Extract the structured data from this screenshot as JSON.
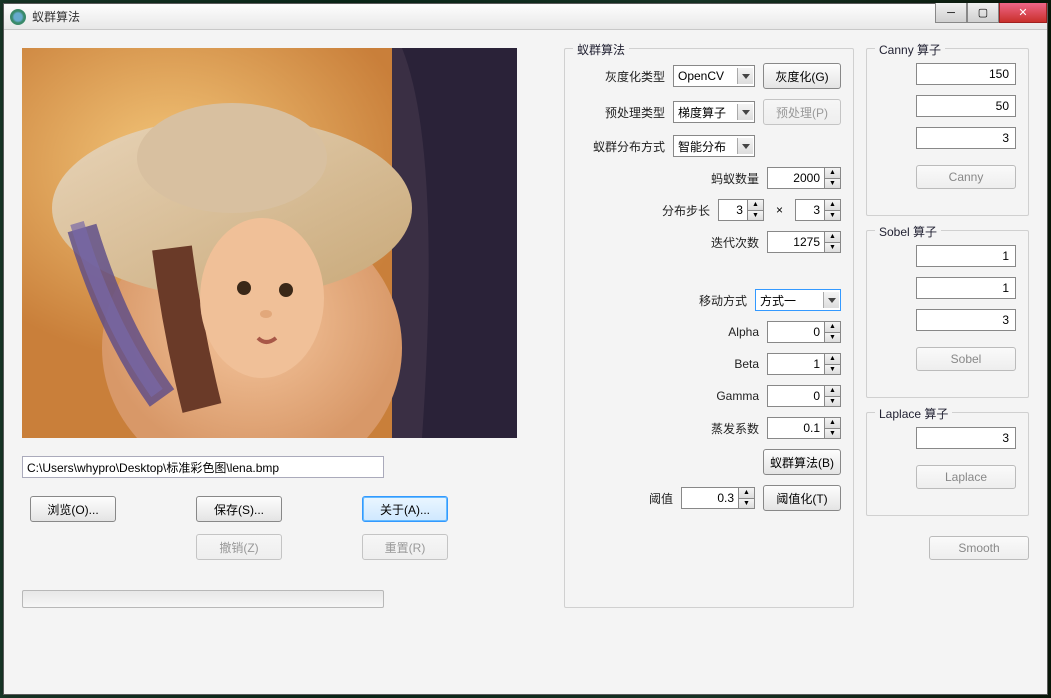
{
  "window": {
    "title": "蚁群算法"
  },
  "left": {
    "path": "C:\\Users\\whypro\\Desktop\\标准彩色图\\lena.bmp",
    "browse": "浏览(O)...",
    "save": "保存(S)...",
    "about": "关于(A)...",
    "undo": "撤销(Z)",
    "reset": "重置(R)"
  },
  "aco": {
    "title": "蚁群算法",
    "gray_type_label": "灰度化类型",
    "gray_type_value": "OpenCV",
    "gray_btn": "灰度化(G)",
    "pre_type_label": "预处理类型",
    "pre_type_value": "梯度算子",
    "pre_btn": "预处理(P)",
    "dist_label": "蚁群分布方式",
    "dist_value": "智能分布",
    "ant_count_label": "蚂蚁数量",
    "ant_count": "2000",
    "step_label": "分布步长",
    "step_x": "3",
    "step_y": "3",
    "iter_label": "迭代次数",
    "iter": "1275",
    "move_label": "移动方式",
    "move_value": "方式一",
    "alpha_label": "Alpha",
    "alpha": "0",
    "beta_label": "Beta",
    "beta": "1",
    "gamma_label": "Gamma",
    "gamma": "0",
    "evap_label": "蒸发系数",
    "evap": "0.1",
    "aco_btn": "蚁群算法(B)",
    "thresh_label": "阈值",
    "thresh": "0.3",
    "thresh_btn": "阈值化(T)"
  },
  "canny": {
    "title": "Canny 算子",
    "v1": "150",
    "v2": "50",
    "v3": "3",
    "btn": "Canny"
  },
  "sobel": {
    "title": "Sobel 算子",
    "v1": "1",
    "v2": "1",
    "v3": "3",
    "btn": "Sobel"
  },
  "laplace": {
    "title": "Laplace 算子",
    "v1": "3",
    "btn": "Laplace"
  },
  "smooth": "Smooth"
}
